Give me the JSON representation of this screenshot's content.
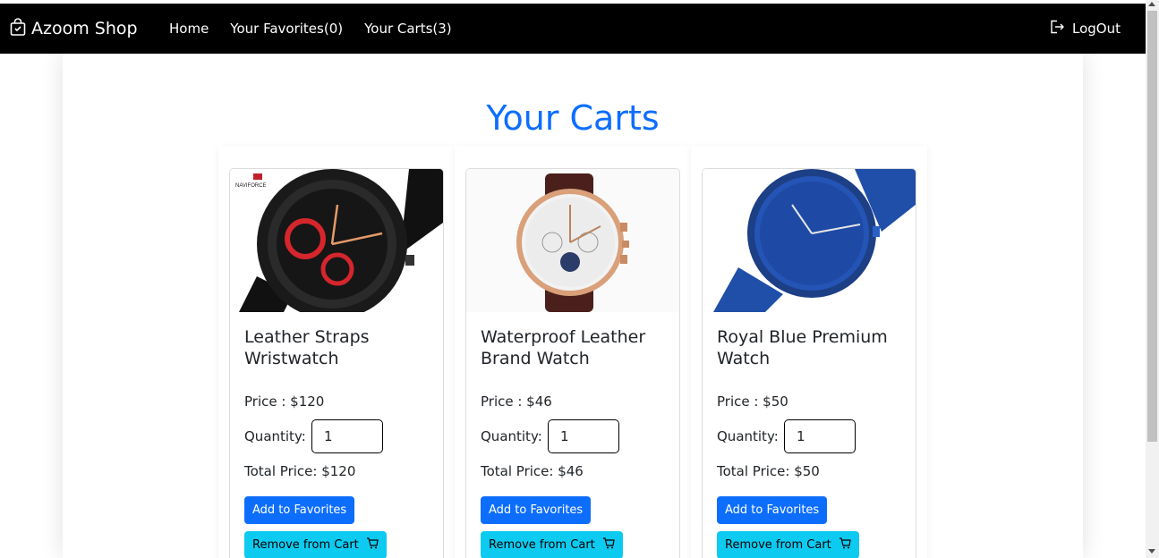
{
  "navbar": {
    "brand": "Azoom Shop",
    "brand_icon": "shopping-bag-icon",
    "links": [
      {
        "label": "Home"
      },
      {
        "label": "Your Favorites(0)"
      },
      {
        "label": "Your Carts(3)"
      }
    ],
    "logout_label": "LogOut",
    "logout_icon": "logout-icon"
  },
  "page": {
    "title": "Your Carts",
    "title_color": "#0d6efd"
  },
  "products": [
    {
      "name": "Leather Straps Wristwatch",
      "price": "Price : $120",
      "quantity_label": "Quantity:",
      "quantity": "1",
      "total": "Total Price: $120",
      "fav_label": "Add to Favorites",
      "remove_label": "Remove from Cart",
      "brand_logo": "NAVIFORCE"
    },
    {
      "name": "Waterproof Leather Brand Watch",
      "price": "Price : $46",
      "quantity_label": "Quantity:",
      "quantity": "1",
      "total": "Total Price: $46",
      "fav_label": "Add to Favorites",
      "remove_label": "Remove from Cart"
    },
    {
      "name": "Royal Blue Premium Watch",
      "price": "Price : $50",
      "quantity_label": "Quantity:",
      "quantity": "1",
      "total": "Total Price: $50",
      "fav_label": "Add to Favorites",
      "remove_label": "Remove from Cart"
    }
  ],
  "colors": {
    "primary": "#0d6efd",
    "info": "#0dcaf0",
    "navbar": "#000000"
  }
}
